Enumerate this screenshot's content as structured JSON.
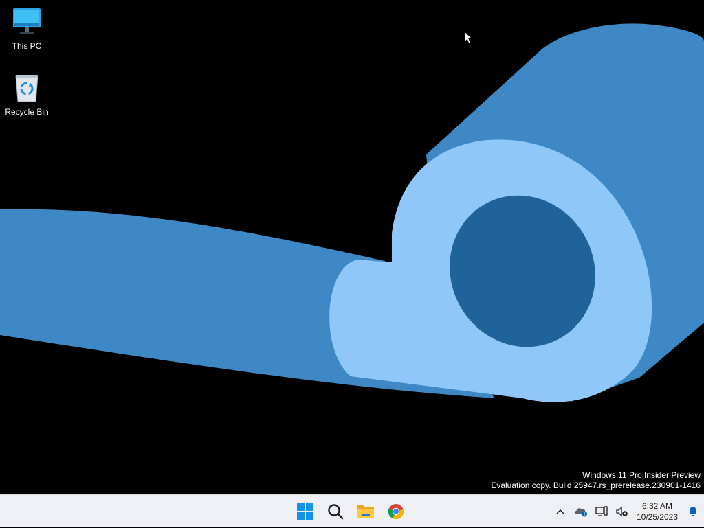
{
  "desktop": {
    "icons": [
      {
        "label": "This PC",
        "icon": "computer-icon"
      },
      {
        "label": "Recycle Bin",
        "icon": "recycle-bin-icon"
      }
    ],
    "watermark": {
      "line1": "Windows 11 Pro Insider Preview",
      "line2": "Evaluation copy. Build 25947.rs_prerelease.230901-1416"
    },
    "wallpaper_colors": {
      "dark_blue": "#3e88c5",
      "light_blue": "#8ec7f8",
      "hole": "#20639a"
    }
  },
  "taskbar": {
    "apps": [
      {
        "name": "Start",
        "icon": "windows-logo-icon"
      },
      {
        "name": "Search",
        "icon": "search-icon"
      },
      {
        "name": "File Explorer",
        "icon": "folder-icon"
      },
      {
        "name": "Google Chrome",
        "icon": "chrome-icon"
      }
    ],
    "tray": {
      "icons": [
        "chevron-up-icon",
        "onedrive-icon",
        "network-icon",
        "volume-muted-icon"
      ],
      "time": "6:32 AM",
      "date": "10/25/2023",
      "notification_icon": "bell-icon"
    },
    "accent": "#0067c0"
  }
}
